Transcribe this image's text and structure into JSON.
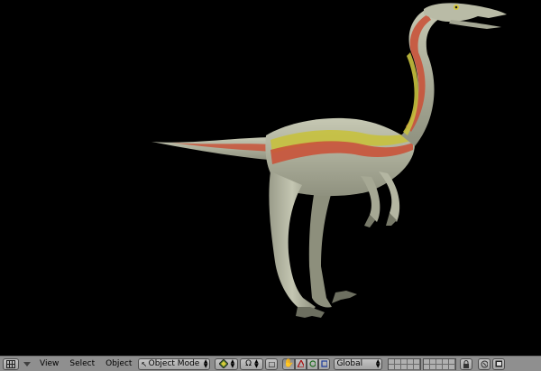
{
  "header": {
    "menus": {
      "view": "View",
      "select": "Select",
      "object": "Object"
    },
    "mode_selector": {
      "value": "Object Mode",
      "icon": "cursor-arrow-icon"
    },
    "orientation_selector": {
      "value": "Global"
    },
    "icons": {
      "editor_type": "grid-icon",
      "menu_toggle": "triangle-icon",
      "draw_type": "sphere-icon",
      "pivot": "pivot-icon",
      "manipulator": "hand-icon",
      "translate": "triangle-widget-icon",
      "rotate": "rotate-icon",
      "scale": "scale-icon",
      "lock": "lock-icon",
      "render": "render-icon",
      "camera": "image-icon"
    }
  },
  "viewport": {
    "background": "#000000",
    "scene_object": "dinosaur-model"
  },
  "colors": {
    "header_bg": "#8f8f8f",
    "body_skin": "#b7b9a4",
    "stripe_red": "#c9533a",
    "stripe_yellow": "#c7c13e"
  }
}
